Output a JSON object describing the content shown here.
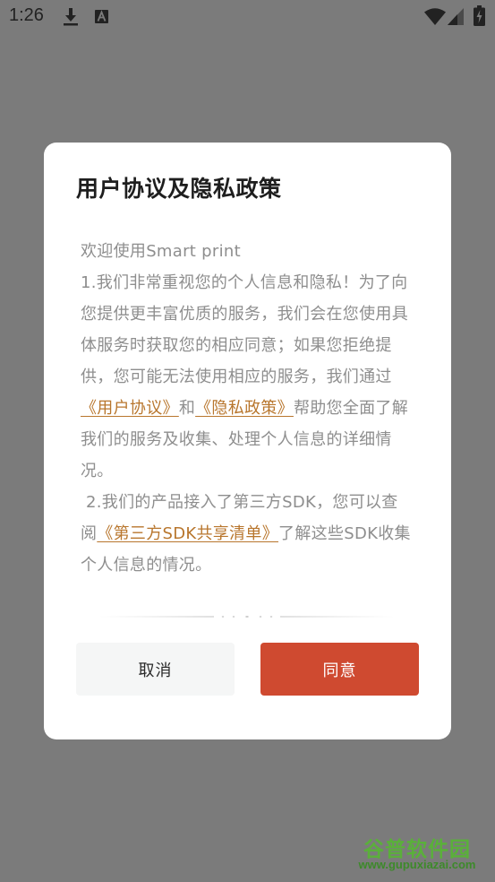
{
  "status_bar": {
    "time": "1:26",
    "icons": [
      "download-icon",
      "notification-a-icon",
      "wifi-icon",
      "cellular-signal-icon",
      "battery-charging-icon"
    ]
  },
  "dialog": {
    "title": "用户协议及隐私政策",
    "welcome": "欢迎使用Smart print",
    "paragraph1": {
      "text_before": "1.我们非常重视您的个人信息和隐私！为了向您提供更丰富优质的服务，我们会在您使用具体服务时获取您的相应同意；如果您拒绝提供，您可能无法使用相应的服务，我们通过",
      "link_user_agreement": "《用户协议》",
      "conjunction": "和",
      "link_privacy_policy": "《隐私政策》",
      "text_after": "帮助您全面了解我们的服务及收集、处理个人信息的详细情况。"
    },
    "paragraph2": {
      "text_before": " 2.我们的产品接入了第三方SDK，您可以查阅",
      "link_sdk_list": "《第三方SDK共享清单》",
      "text_after": "了解这些SDK收集个人信息的情况。"
    },
    "buttons": {
      "cancel": "取消",
      "agree": "同意"
    }
  },
  "colors": {
    "overlay": "#7b7b7b",
    "link": "#b8762d",
    "agree_button": "#cf4a30",
    "cancel_button": "#f5f6f6"
  },
  "watermark": {
    "title": "谷普软件园",
    "url": "www.gupuxiazai.com"
  }
}
